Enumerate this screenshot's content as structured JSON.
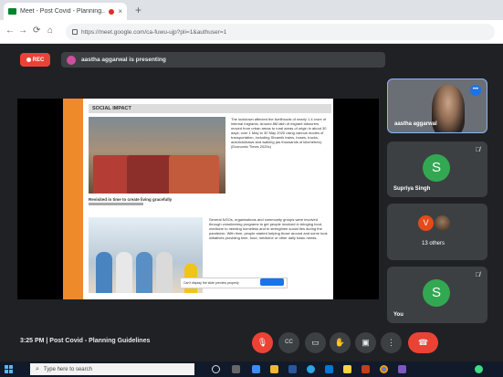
{
  "browser": {
    "tab_title": "Meet - Post Covid - Planning...",
    "tab_close": "×",
    "new_tab": "+",
    "back": "←",
    "forward": "→",
    "reload": "⟳",
    "home": "⌂",
    "url": "https://meet.google.com/ca-fuwu-ujp?pli=1&authuser=1"
  },
  "meet": {
    "rec_label": "REC",
    "presenting_text": "aastha aggarwal is presenting",
    "slide": {
      "heading": "SOCIAL IMPACT",
      "paragraph1": "The lockdown affected the livelihoods of nearly 1.4 crore of internal migrants. Around 8M lakh of migrant labourers moved from urban areas to rural areas of origin in about 30 days; over 1 May to 30 May 2020 using various modes of transportation, including Shramik trains, buses, trucks, autorickshaws and walking (as thousands of kilometres). (Economic Times 2020c)",
      "caption": "Revisited in time to create living gracefully",
      "paragraph2": "Several NGOs, organisations and community groups were involved through volunteering programs to get people involved in bringing food, medicine to needing homeless and to strengthen social ties during the pandemic. With time, people started helping those around and some took initiatives providing time, food, medicine or other daily basic needs.",
      "popup_text": "Can't display the slide preview properly"
    },
    "participants": [
      {
        "name": "aastha aggarwal",
        "kind": "video"
      },
      {
        "name": "Supriya Singh",
        "avatar": "S",
        "kind": "avatar"
      },
      {
        "name": "13 others",
        "avatar": "V",
        "kind": "group"
      },
      {
        "name": "You",
        "avatar": "S",
        "kind": "avatar"
      }
    ],
    "more_options": "•••",
    "mic_off": "🎙̸",
    "meeting_info": "3:25 PM  |  Post Covid - Planning Guidelines",
    "controls": {
      "mic": "🎙",
      "captions": "CC",
      "present": "▭",
      "raise_hand": "✋",
      "activities": "▣",
      "more": "⋮",
      "leave": "☎"
    }
  },
  "taskbar": {
    "search_placeholder": "Type here to search",
    "search_icon": "⌕"
  },
  "colors": {
    "meet_bg": "#202124",
    "tile_bg": "#3c4043",
    "danger": "#ea4335",
    "avatar_green": "#33a852",
    "accent_blue": "#1a73e8",
    "slide_orange": "#ef8a2b"
  }
}
